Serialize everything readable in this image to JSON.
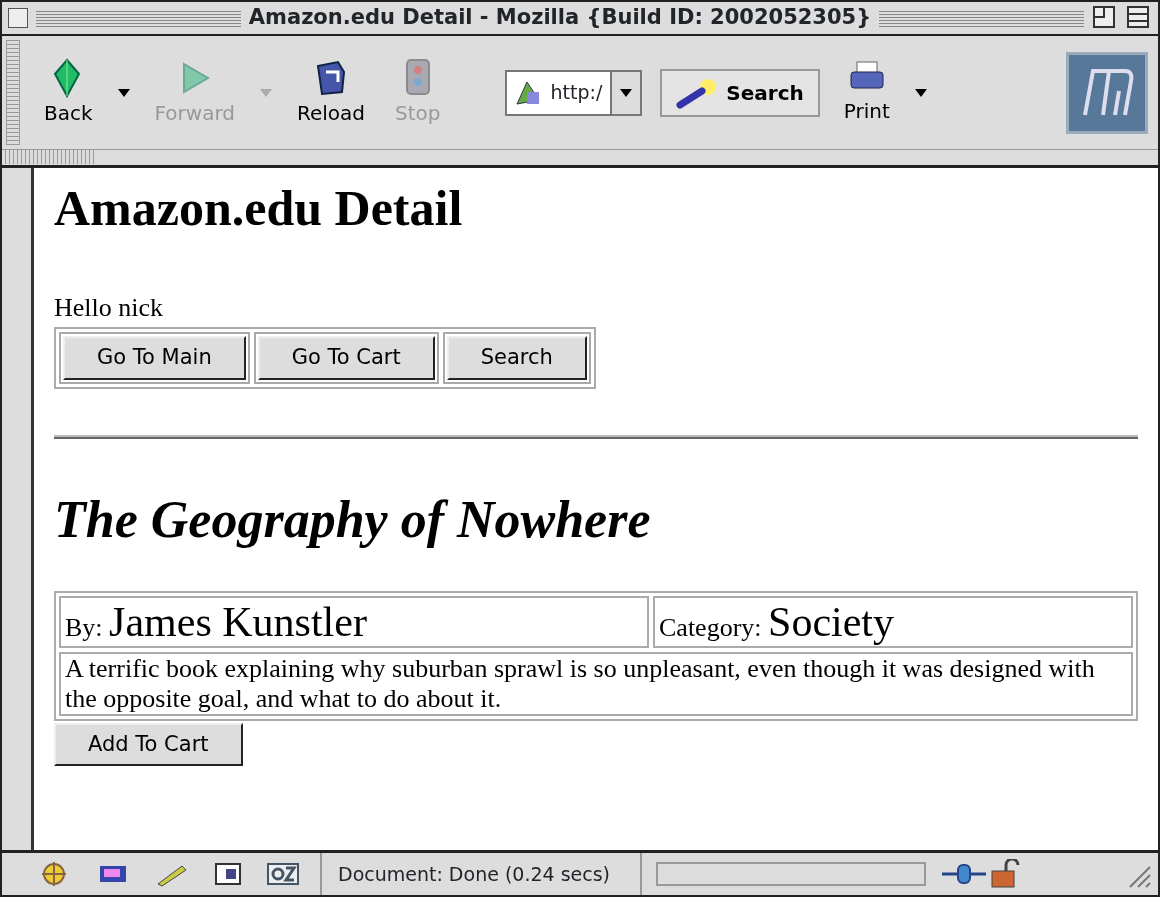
{
  "window": {
    "title": "Amazon.edu Detail - Mozilla {Build ID: 2002052305}"
  },
  "toolbar": {
    "buttons": [
      {
        "kind": "back",
        "label": "Back",
        "disabled": false,
        "has_menu": true
      },
      {
        "kind": "forward",
        "label": "Forward",
        "disabled": true,
        "has_menu": true
      },
      {
        "kind": "reload",
        "label": "Reload",
        "disabled": false,
        "has_menu": false
      },
      {
        "kind": "stop",
        "label": "Stop",
        "disabled": true,
        "has_menu": false
      }
    ],
    "url": "http:/",
    "search": "Search",
    "print": "Print"
  },
  "page": {
    "heading": "Amazon.edu Detail",
    "greeting": "Hello nick",
    "nav_buttons": [
      "Go To Main",
      "Go To Cart",
      "Search"
    ],
    "book": {
      "title": "The Geography of Nowhere",
      "author_label": "By:",
      "author": "James Kunstler",
      "category_label": "Category:",
      "category": "Society",
      "description": "A terrific book explaining why suburban sprawl is so unpleasant, even though it was designed with the opposite goal, and what to do about it."
    },
    "add_button": "Add To Cart"
  },
  "status_bar": {
    "text": "Document: Done (0.24 secs)",
    "level": 0
  }
}
